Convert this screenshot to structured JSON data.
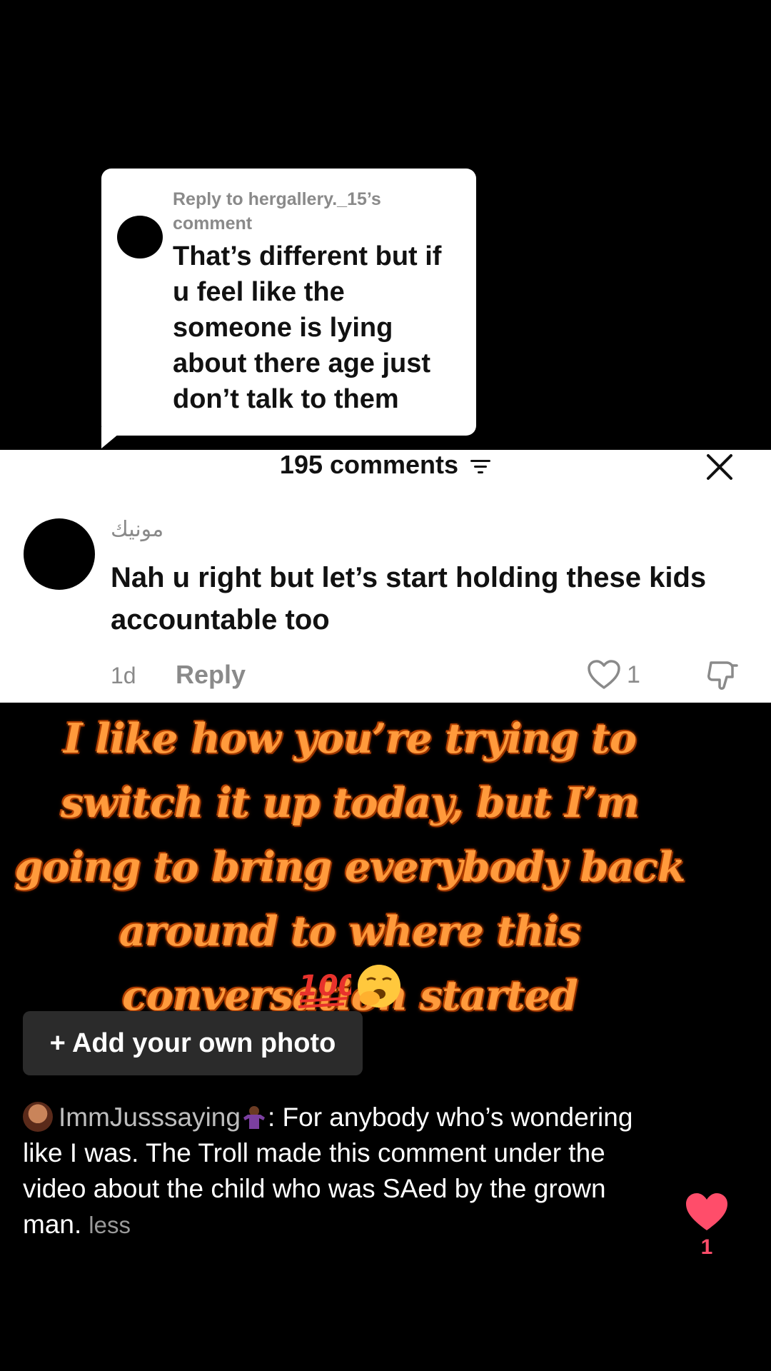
{
  "reply_bubble": {
    "reply_to": "Reply to hergallery._15’s comment",
    "text": "That’s different but if u feel like the someone is lying about there age just don’t talk to them"
  },
  "comments_panel": {
    "count_label": "195 comments",
    "comment": {
      "username": "مونيك",
      "text": "Nah u right but let’s start holding these kids accountable too",
      "time": "1d",
      "reply_label": "Reply",
      "like_count": "1"
    }
  },
  "caption": {
    "text": "I like how you’re trying to switch it up today, but I’m going to bring everybody back around to where this conversation started"
  },
  "add_photo": {
    "label": "+ Add your own photo"
  },
  "description": {
    "username": "ImmJusssaying",
    "text": ": For anybody who’s wondering like I was. The Troll made this comment under the video about the child who was SAed by the grown man.",
    "less_label": "less"
  },
  "like_widget": {
    "count": "1",
    "color": "#ff4d6a"
  },
  "icons": [
    "filter-icon",
    "close-icon",
    "heart-outline-icon",
    "dislike-icon",
    "hundred-points-emoji",
    "yawning-face-emoji",
    "person-shrugging-emoji",
    "heart-filled-icon"
  ]
}
